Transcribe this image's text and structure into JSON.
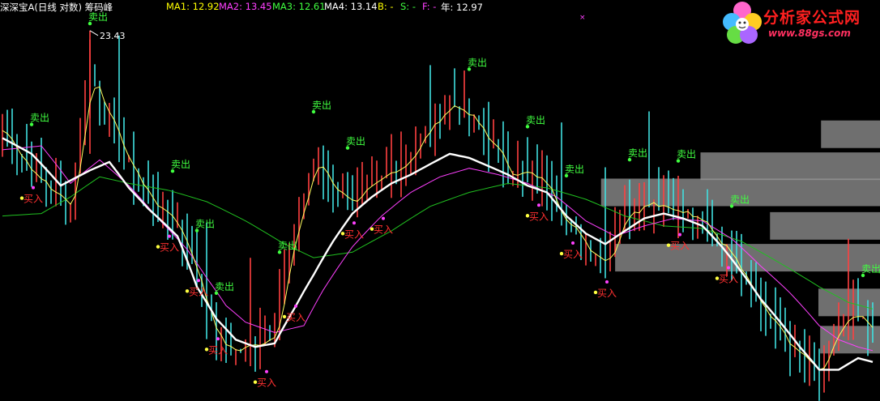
{
  "header": {
    "title": "深深宝A(日线 对数) 筹码峰",
    "ma1": "MA1: 12.92",
    "ma2": "MA2: 13.45",
    "ma3": "MA3: 12.61",
    "ma4": "MA4: 13.14",
    "b": "B: -",
    "s": "S: -",
    "f": "F: -",
    "year": "年: 12.97",
    "colors": {
      "title": "#ffffff",
      "ma1": "#ffff00",
      "ma2": "#ff40ff",
      "ma3": "#40ff40",
      "ma4": "#ffffff",
      "b": "#ffff00",
      "s": "#40ff40",
      "f": "#ff40ff",
      "year": "#ffffff"
    }
  },
  "logo": {
    "title": "分析家公式网",
    "url": "www.88gs.com"
  },
  "chart_data": {
    "type": "line",
    "scale": "log",
    "peak_label": "23.43",
    "y_range": [
      7.5,
      24.5
    ],
    "grid": false,
    "n_bars": 180,
    "colors": {
      "up": "#ff4040",
      "down": "#40e0e0",
      "ma1": "#ffff60",
      "ma2": "#ff40ff",
      "ma3": "#20c020",
      "ma4": "#ffffff",
      "sell": "#40ff40",
      "buy": "#ff3030"
    },
    "close_anchors": [
      [
        0,
        17.2
      ],
      [
        6,
        15.0
      ],
      [
        10,
        14.2
      ],
      [
        14,
        13.6
      ],
      [
        18,
        20.5
      ],
      [
        22,
        17.6
      ],
      [
        25,
        15.8
      ],
      [
        30,
        13.9
      ],
      [
        36,
        12.8
      ],
      [
        40,
        10.8
      ],
      [
        44,
        8.9
      ],
      [
        48,
        8.7
      ],
      [
        52,
        8.9
      ],
      [
        56,
        9.3
      ],
      [
        60,
        12.5
      ],
      [
        64,
        15.6
      ],
      [
        68,
        14.4
      ],
      [
        72,
        13.8
      ],
      [
        76,
        14.3
      ],
      [
        80,
        15.2
      ],
      [
        84,
        16.0
      ],
      [
        88,
        17.4
      ],
      [
        92,
        18.8
      ],
      [
        96,
        17.8
      ],
      [
        100,
        16.6
      ],
      [
        104,
        15.2
      ],
      [
        108,
        14.9
      ],
      [
        112,
        14.6
      ],
      [
        116,
        12.8
      ],
      [
        120,
        12.0
      ],
      [
        124,
        11.5
      ],
      [
        128,
        13.3
      ],
      [
        132,
        13.9
      ],
      [
        136,
        13.7
      ],
      [
        140,
        13.3
      ],
      [
        144,
        12.8
      ],
      [
        148,
        12.1
      ],
      [
        152,
        11.2
      ],
      [
        156,
        9.9
      ],
      [
        160,
        9.1
      ],
      [
        164,
        8.5
      ],
      [
        168,
        8.0
      ],
      [
        172,
        9.4
      ],
      [
        176,
        9.6
      ],
      [
        179,
        9.0
      ]
    ],
    "ma4_anchors": [
      [
        0,
        16.8
      ],
      [
        6,
        16.0
      ],
      [
        12,
        14.5
      ],
      [
        18,
        15.2
      ],
      [
        22,
        15.6
      ],
      [
        26,
        14.4
      ],
      [
        30,
        13.5
      ],
      [
        36,
        12.4
      ],
      [
        40,
        10.6
      ],
      [
        44,
        9.6
      ],
      [
        48,
        9.0
      ],
      [
        52,
        8.8
      ],
      [
        56,
        8.9
      ],
      [
        60,
        9.9
      ],
      [
        64,
        11.0
      ],
      [
        68,
        12.2
      ],
      [
        72,
        13.3
      ],
      [
        76,
        14.0
      ],
      [
        80,
        14.6
      ],
      [
        84,
        15.0
      ],
      [
        88,
        15.5
      ],
      [
        92,
        16.0
      ],
      [
        96,
        15.8
      ],
      [
        100,
        15.4
      ],
      [
        104,
        15.0
      ],
      [
        108,
        14.5
      ],
      [
        112,
        14.2
      ],
      [
        116,
        13.2
      ],
      [
        120,
        12.5
      ],
      [
        124,
        12.1
      ],
      [
        128,
        12.6
      ],
      [
        132,
        13.1
      ],
      [
        136,
        13.3
      ],
      [
        140,
        13.1
      ],
      [
        144,
        12.8
      ],
      [
        148,
        12.0
      ],
      [
        152,
        11.1
      ],
      [
        156,
        10.2
      ],
      [
        160,
        9.5
      ],
      [
        164,
        8.8
      ],
      [
        168,
        8.2
      ],
      [
        172,
        8.2
      ],
      [
        176,
        8.5
      ],
      [
        179,
        8.4
      ]
    ],
    "ma2_anchors": [
      [
        0,
        16.2
      ],
      [
        8,
        16.4
      ],
      [
        14,
        14.6
      ],
      [
        20,
        15.7
      ],
      [
        26,
        14.5
      ],
      [
        32,
        13.1
      ],
      [
        38,
        11.9
      ],
      [
        42,
        10.9
      ],
      [
        46,
        10.0
      ],
      [
        50,
        9.5
      ],
      [
        56,
        9.2
      ],
      [
        62,
        9.4
      ],
      [
        66,
        10.5
      ],
      [
        72,
        12.0
      ],
      [
        78,
        13.2
      ],
      [
        84,
        14.2
      ],
      [
        90,
        14.9
      ],
      [
        96,
        15.3
      ],
      [
        102,
        15.0
      ],
      [
        108,
        14.6
      ],
      [
        114,
        14.0
      ],
      [
        120,
        13.0
      ],
      [
        126,
        12.4
      ],
      [
        132,
        12.8
      ],
      [
        138,
        13.1
      ],
      [
        144,
        13.0
      ],
      [
        150,
        12.3
      ],
      [
        156,
        11.3
      ],
      [
        162,
        10.4
      ],
      [
        168,
        9.4
      ],
      [
        172,
        9.0
      ],
      [
        176,
        8.8
      ],
      [
        179,
        8.7
      ]
    ],
    "ma3_anchors": [
      [
        0,
        13.2
      ],
      [
        8,
        13.3
      ],
      [
        14,
        14.0
      ],
      [
        20,
        14.9
      ],
      [
        26,
        14.6
      ],
      [
        34,
        14.3
      ],
      [
        42,
        13.8
      ],
      [
        50,
        13.0
      ],
      [
        58,
        12.1
      ],
      [
        64,
        11.6
      ],
      [
        72,
        11.8
      ],
      [
        80,
        12.6
      ],
      [
        88,
        13.6
      ],
      [
        96,
        14.2
      ],
      [
        104,
        14.6
      ],
      [
        112,
        14.4
      ],
      [
        120,
        13.9
      ],
      [
        128,
        13.2
      ],
      [
        136,
        12.8
      ],
      [
        144,
        12.7
      ],
      [
        152,
        12.2
      ],
      [
        160,
        11.4
      ],
      [
        168,
        10.6
      ],
      [
        174,
        10.1
      ],
      [
        179,
        9.9
      ]
    ],
    "sell_signals": [
      [
        6,
        "卖出"
      ],
      [
        18,
        "卖出"
      ],
      [
        35,
        "卖出"
      ],
      [
        40,
        "卖出"
      ],
      [
        44,
        "卖出"
      ],
      [
        57,
        "卖出"
      ],
      [
        64,
        "卖出"
      ],
      [
        71,
        "卖出"
      ],
      [
        96,
        "卖出"
      ],
      [
        108,
        "卖出"
      ],
      [
        116,
        "卖出"
      ],
      [
        129,
        "卖出"
      ],
      [
        139,
        "卖出"
      ],
      [
        150,
        "卖出"
      ],
      [
        177,
        "卖出"
      ]
    ],
    "buy_signals": [
      [
        4,
        "买入"
      ],
      [
        32,
        "买入"
      ],
      [
        38,
        "买入"
      ],
      [
        42,
        "买入"
      ],
      [
        52,
        "买入"
      ],
      [
        58,
        "买入"
      ],
      [
        70,
        "买入"
      ],
      [
        76,
        "买入"
      ],
      [
        108,
        "买入"
      ],
      [
        115,
        "买入"
      ],
      [
        122,
        "买入"
      ],
      [
        137,
        "买入"
      ],
      [
        147,
        "买入"
      ]
    ],
    "chip_peaks": [
      {
        "price": 17.0,
        "length": 0.067
      },
      {
        "price": 15.4,
        "length": 0.204
      },
      {
        "price": 14.2,
        "length": 0.317
      },
      {
        "price": 12.8,
        "length": 0.125
      },
      {
        "price": 11.6,
        "length": 0.301
      },
      {
        "price": 10.1,
        "length": 0.07
      },
      {
        "price": 9.0,
        "length": 0.068
      }
    ]
  }
}
